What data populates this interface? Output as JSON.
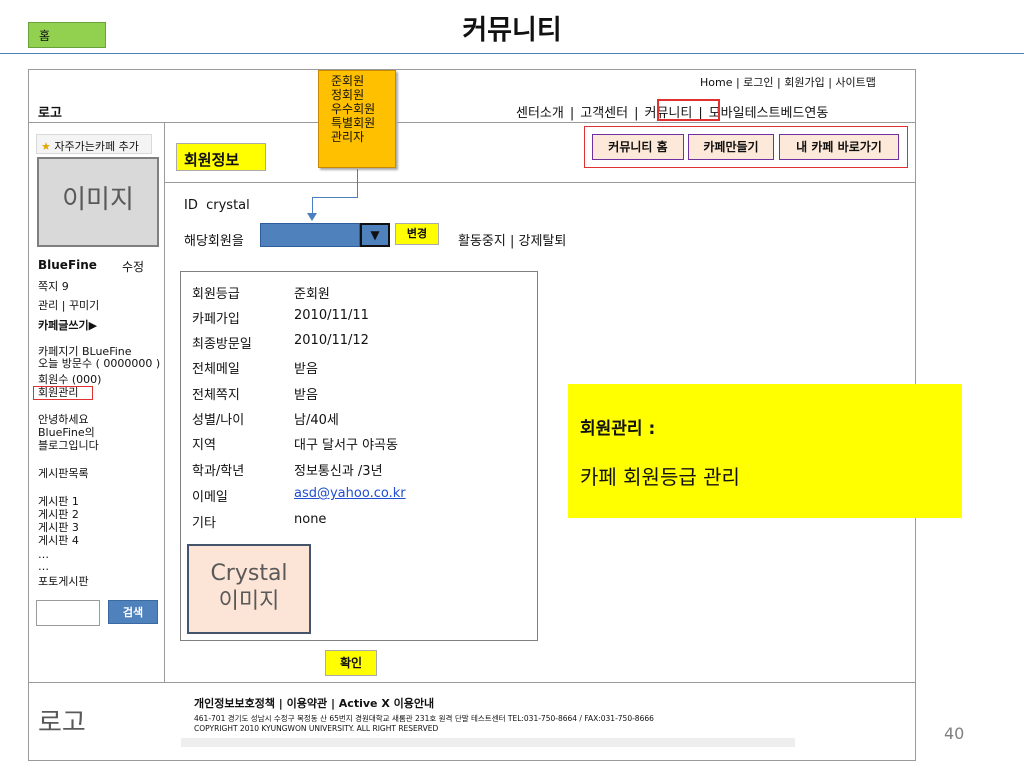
{
  "slide": {
    "home_tab": "홈",
    "title": "커뮤니티",
    "page_number": "40"
  },
  "header": {
    "top_links": "Home | 로그인 | 회원가입 | 사이트맵",
    "logo": "로고",
    "nav": [
      "센터소개",
      "고객센터",
      "커뮤니티",
      "모바일테스트베드연동"
    ]
  },
  "grade_dropdown": {
    "options": [
      "준회원",
      "정회원",
      "우수회원",
      "특별회원",
      "관리자"
    ]
  },
  "cafe_buttons": [
    "커뮤니티 홈",
    "카페만들기",
    "내 카페 바로가기"
  ],
  "sidebar": {
    "favorite_button": "자주가는카페 추가",
    "image_placeholder": "이미지",
    "username": "BlueFine",
    "edit": "수정",
    "messages": "쪽지 9",
    "manage_decorate": "관리 | 꾸미기",
    "write_post": "카페글쓰기▶",
    "cafe_keeper": "카페지기 BLueFine",
    "visitors_today": "오늘 방문수 ( 0000000 )",
    "member_count": "회원수 (000)",
    "member_management": "회원관리",
    "greeting": [
      "안녕하세요",
      "BlueFine의",
      "블로그입니다"
    ],
    "board_list": "게시판목록",
    "boards": [
      "게시판 1",
      "게시판 2",
      "게시판 3",
      "게시판 4",
      "…",
      "…",
      "포토게시판"
    ],
    "search_button": "검색"
  },
  "main": {
    "section_label": "회원정보",
    "id_label": "ID",
    "id_value": "crystal",
    "member_select_label": "해당회원을",
    "select_arrow": "▼",
    "change_button": "변경",
    "actions": "활동중지 | 강제탈퇴",
    "info": [
      {
        "label": "회원등급",
        "value": "준회원"
      },
      {
        "label": "카페가입",
        "value": "2010/11/11"
      },
      {
        "label": "최종방문일",
        "value": "2010/11/12"
      },
      {
        "label": "전체메일",
        "value": "받음"
      },
      {
        "label": "전체쪽지",
        "value": "받음"
      },
      {
        "label": "성별/나이",
        "value": "남/40세"
      },
      {
        "label": "지역",
        "value": "대구 달서구 야곡동"
      },
      {
        "label": "학과/학년",
        "value": "정보통신과 /3년"
      },
      {
        "label": "이메일",
        "value": "asd@yahoo.co.kr"
      },
      {
        "label": "기타",
        "value": "none"
      }
    ],
    "crystal_image_line1": "Crystal",
    "crystal_image_line2": "이미지",
    "confirm_button": "확인"
  },
  "annotation": {
    "title": "회원관리 :",
    "body": "카페 회원등급 관리"
  },
  "footer": {
    "logo": "로고",
    "links": "개인정보보호정책 | 이용약관 | Active X 이용안내",
    "address": "461-701 경기도 성남시 수정구 복정동 산 65번지 경원대학교 새롬관 231호 원격 단말 테스트센터 TEL:031-750-8664 / FAX:031-750-8666",
    "copyright": "COPYRIGHT 2010 KYUNGWON UNIVERSITY.  ALL RIGHT RESERVED"
  }
}
